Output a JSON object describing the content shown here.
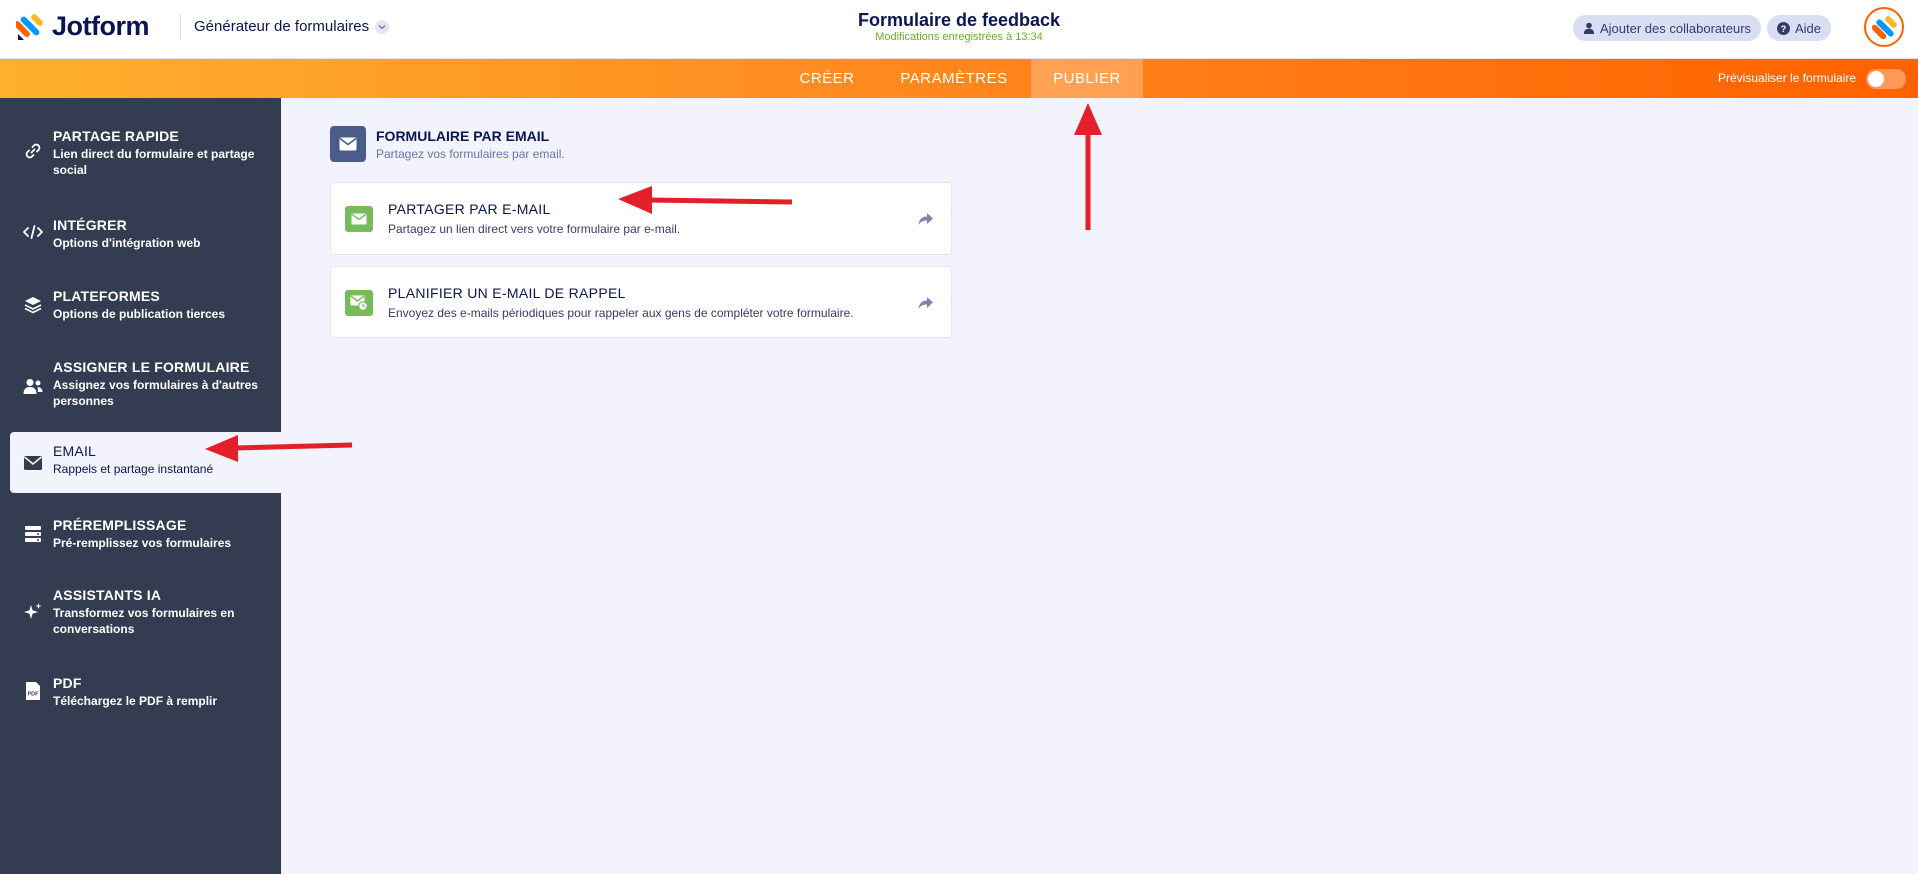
{
  "header": {
    "logo_text": "Jotform",
    "builder_switch": "Générateur de formulaires",
    "form_title": "Formulaire de feedback",
    "save_status": "Modifications enregistrées à 13:34",
    "add_collaborators": "Ajouter des collaborateurs",
    "help": "Aide"
  },
  "topnav": {
    "tabs": [
      {
        "label": "CRÉER"
      },
      {
        "label": "PARAMÈTRES"
      },
      {
        "label": "PUBLIER",
        "active": true
      }
    ],
    "preview_label": "Prévisualiser le formulaire",
    "preview_enabled": false
  },
  "sidebar": {
    "items": [
      {
        "title": "PARTAGE RAPIDE",
        "subtitle": "Lien direct du formulaire et partage social",
        "icon": "link-icon"
      },
      {
        "title": "INTÉGRER",
        "subtitle": "Options d'intégration web",
        "icon": "code-icon"
      },
      {
        "title": "PLATEFORMES",
        "subtitle": "Options de publication tierces",
        "icon": "layers-icon"
      },
      {
        "title": "ASSIGNER LE FORMULAIRE",
        "subtitle": "Assignez vos formulaires à d'autres personnes",
        "icon": "assign-user-icon"
      },
      {
        "title": "EMAIL",
        "subtitle": "Rappels et partage instantané",
        "icon": "envelope-icon",
        "active": true
      },
      {
        "title": "PRÉREMPLISSAGE",
        "subtitle": "Pré-remplissez vos formulaires",
        "icon": "prefill-icon"
      },
      {
        "title": "ASSISTANTS IA",
        "subtitle": "Transformez vos formulaires en conversations",
        "icon": "sparkle-icon"
      },
      {
        "title": "PDF",
        "subtitle": "Téléchargez le PDF à remplir",
        "icon": "pdf-icon"
      }
    ]
  },
  "main": {
    "section_title": "FORMULAIRE PAR EMAIL",
    "section_subtitle": "Partagez vos formulaires par email.",
    "cards": [
      {
        "title": "PARTAGER PAR E-MAIL",
        "subtitle": "Partagez un lien direct vers votre formulaire par e-mail.",
        "icon": "mail-icon"
      },
      {
        "title": "PLANIFIER UN E-MAIL DE RAPPEL",
        "subtitle": "Envoyez des e-mails périodiques pour rappeler aux gens de compléter votre formulaire.",
        "icon": "reminder-mail-icon"
      }
    ]
  },
  "colors": {
    "accent_orange": "#ff6100",
    "sidebar_bg": "#343c52",
    "annotation_arrow": "#e3202a",
    "card_icon_green": "#78bb5a"
  }
}
